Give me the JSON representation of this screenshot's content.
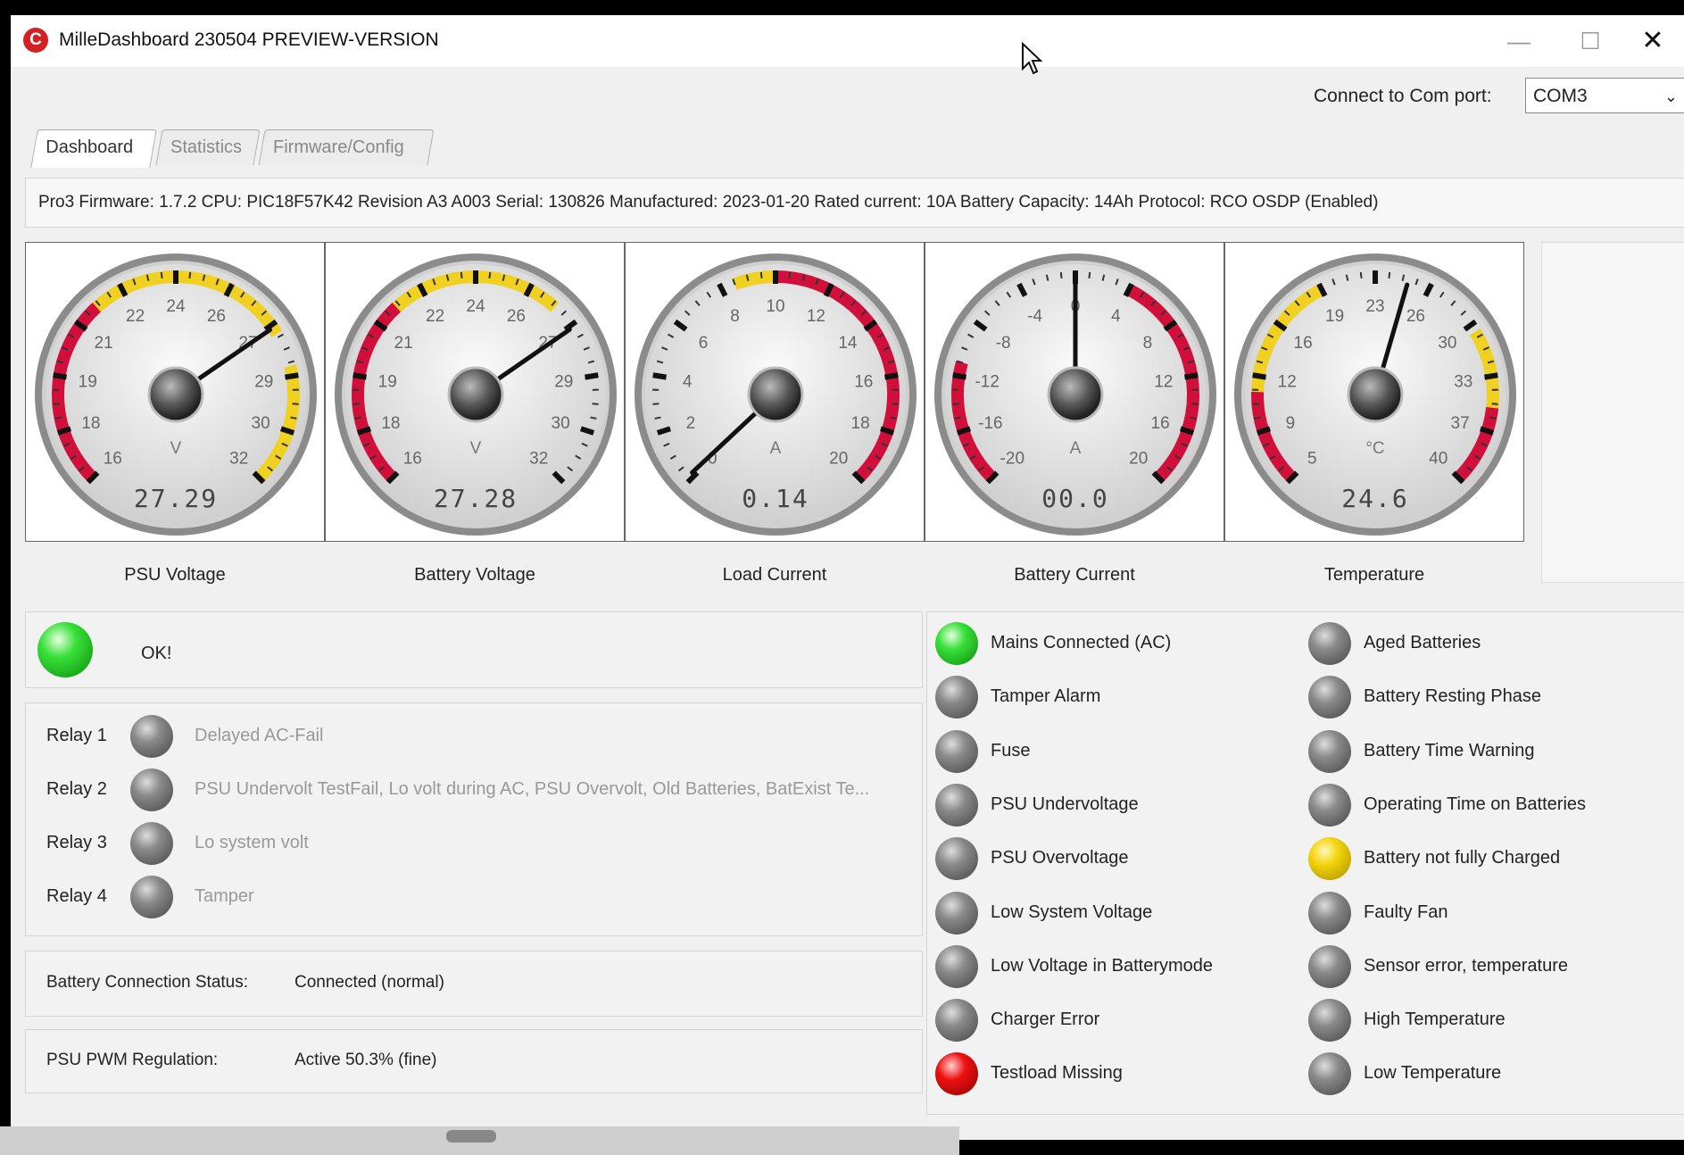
{
  "window": {
    "title": "MilleDashboard 230504 PREVIEW-VERSION",
    "icon": "app-logo-icon",
    "controls": {
      "minimize": "—",
      "maximize": "☐",
      "close": "✕"
    }
  },
  "connection": {
    "label": "Connect to Com port:",
    "port": "COM3"
  },
  "tabs": [
    {
      "label": "Dashboard",
      "active": true
    },
    {
      "label": "Statistics",
      "active": false
    },
    {
      "label": "Firmware/Config",
      "active": false
    }
  ],
  "device_info": "Pro3  Firmware: 1.7.2 CPU: PIC18F57K42 Revision A3 A003 Serial: 130826 Manufactured: 2023-01-20 Rated current: 10A Battery Capacity: 14Ah Protocol: RCO OSDP (Enabled)",
  "gauges": [
    {
      "label": "PSU Voltage",
      "unit": "V",
      "display": "27.29",
      "value": 27.29,
      "min": 16,
      "max": 32,
      "ticks": [
        "16",
        "18",
        "19",
        "21",
        "22",
        "24",
        "26",
        "27",
        "29",
        "30",
        "32"
      ],
      "bands": [
        {
          "from": 16,
          "to": 21.5,
          "color": "#d0103a"
        },
        {
          "from": 21.5,
          "to": 27.5,
          "color": "#f0d020"
        },
        {
          "from": 28.5,
          "to": 32,
          "color": "#f0d020"
        }
      ]
    },
    {
      "label": "Battery Voltage",
      "unit": "V",
      "display": "27.28",
      "value": 27.28,
      "min": 16,
      "max": 32,
      "ticks": [
        "16",
        "18",
        "19",
        "21",
        "22",
        "24",
        "26",
        "27",
        "29",
        "30",
        "32"
      ],
      "bands": [
        {
          "from": 16,
          "to": 21.5,
          "color": "#d0103a"
        },
        {
          "from": 21.5,
          "to": 26.5,
          "color": "#f0d020"
        }
      ]
    },
    {
      "label": "Load Current",
      "unit": "A",
      "display": "0.14",
      "value": 0.14,
      "min": 0,
      "max": 20,
      "ticks": [
        "0",
        "2",
        "4",
        "6",
        "8",
        "10",
        "12",
        "14",
        "16",
        "18",
        "20"
      ],
      "bands": [
        {
          "from": 8.5,
          "to": 10,
          "color": "#f0d020"
        },
        {
          "from": 10,
          "to": 20,
          "color": "#d0103a"
        }
      ]
    },
    {
      "label": "Battery Current",
      "unit": "A",
      "display": "00.0",
      "value": 0.0,
      "min": -20,
      "max": 20,
      "ticks": [
        "-20",
        "-16",
        "-12",
        "-8",
        "-4",
        "0",
        "4",
        "8",
        "12",
        "16",
        "20"
      ],
      "bands": [
        {
          "from": -20,
          "to": -11,
          "color": "#d0103a"
        },
        {
          "from": 4,
          "to": 20,
          "color": "#d0103a"
        }
      ]
    },
    {
      "label": "Temperature",
      "unit": "°C",
      "display": "24.6",
      "value": 24.6,
      "min": 5,
      "max": 40,
      "ticks": [
        "5",
        "9",
        "12",
        "16",
        "19",
        "23",
        "26",
        "30",
        "33",
        "37",
        "40"
      ],
      "bands": [
        {
          "from": 5,
          "to": 11,
          "color": "#d0103a"
        },
        {
          "from": 11,
          "to": 19,
          "color": "#f0d020"
        },
        {
          "from": 30,
          "to": 35,
          "color": "#f0d020"
        },
        {
          "from": 35,
          "to": 40,
          "color": "#d0103a"
        }
      ]
    }
  ],
  "status": {
    "text": "OK!",
    "led": "green"
  },
  "relays": [
    {
      "label": "Relay 1",
      "led": "gray",
      "description": "Delayed AC-Fail"
    },
    {
      "label": "Relay 2",
      "led": "gray",
      "description": "PSU Undervolt TestFail, Lo volt during AC, PSU Overvolt, Old Batteries, BatExist Te..."
    },
    {
      "label": "Relay 3",
      "led": "gray",
      "description": "Lo system volt"
    },
    {
      "label": "Relay 4",
      "led": "gray",
      "description": "Tamper"
    }
  ],
  "battery_connection": {
    "label": "Battery Connection Status:",
    "value": "Connected (normal)"
  },
  "pwm_regulation": {
    "label": "PSU PWM Regulation:",
    "value": "Active 50.3% (fine)"
  },
  "indicators_left": [
    {
      "label": "Mains Connected (AC)",
      "led": "green"
    },
    {
      "label": "Tamper Alarm",
      "led": "gray"
    },
    {
      "label": "Fuse",
      "led": "gray"
    },
    {
      "label": "PSU Undervoltage",
      "led": "gray"
    },
    {
      "label": "PSU Overvoltage",
      "led": "gray"
    },
    {
      "label": "Low System Voltage",
      "led": "gray"
    },
    {
      "label": "Low Voltage in Batterymode",
      "led": "gray"
    },
    {
      "label": "Charger Error",
      "led": "gray"
    },
    {
      "label": "Testload Missing",
      "led": "red"
    }
  ],
  "indicators_right": [
    {
      "label": "Aged Batteries",
      "led": "gray"
    },
    {
      "label": "Battery Resting Phase",
      "led": "gray"
    },
    {
      "label": "Battery Time Warning",
      "led": "gray"
    },
    {
      "label": "Operating Time on Batteries",
      "led": "gray"
    },
    {
      "label": "Battery not fully Charged",
      "led": "yellow"
    },
    {
      "label": "Faulty Fan",
      "led": "gray"
    },
    {
      "label": "Sensor error, temperature",
      "led": "gray"
    },
    {
      "label": "High Temperature",
      "led": "gray"
    },
    {
      "label": "Low Temperature",
      "led": "gray"
    }
  ]
}
